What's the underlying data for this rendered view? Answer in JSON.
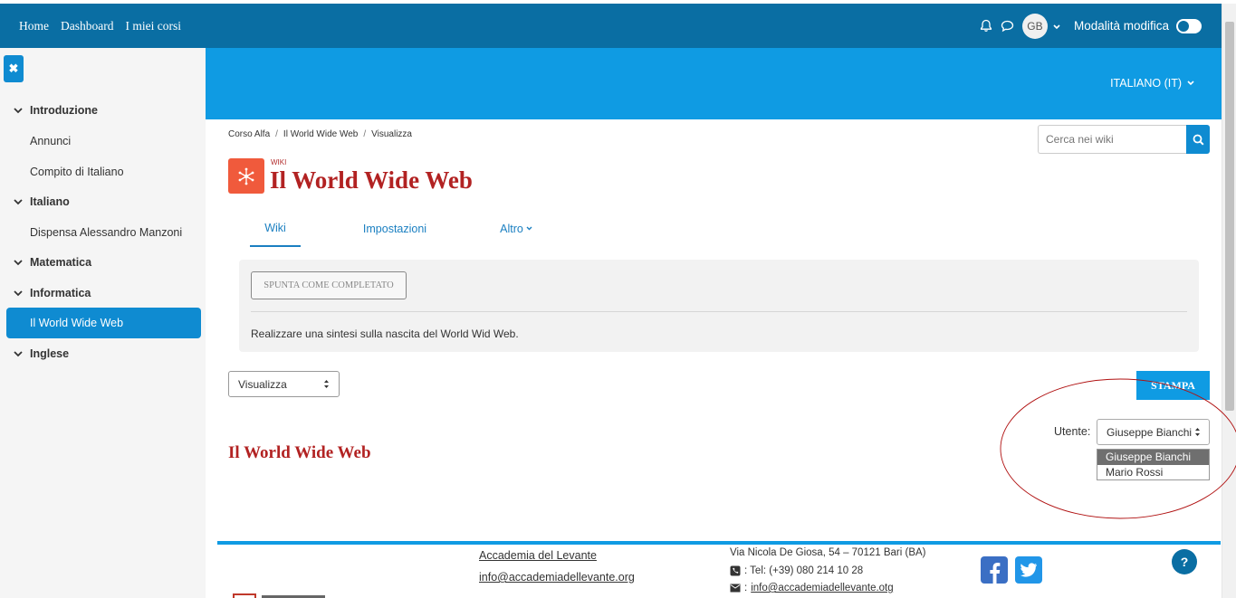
{
  "nav": {
    "home": "Home",
    "dashboard": "Dashboard",
    "my_courses": "I miei corsi",
    "avatar_initials": "GB",
    "edit_mode": "Modalità modifica"
  },
  "sidebar": {
    "close_glyph": "✖",
    "items": [
      {
        "label": "Introduzione",
        "type": "section"
      },
      {
        "label": "Annunci",
        "type": "leaf"
      },
      {
        "label": "Compito di Italiano",
        "type": "leaf"
      },
      {
        "label": "Italiano",
        "type": "section"
      },
      {
        "label": "Dispensa Alessandro Manzoni",
        "type": "leaf"
      },
      {
        "label": "Matematica",
        "type": "section"
      },
      {
        "label": "Informatica",
        "type": "section"
      },
      {
        "label": "Il World Wide Web",
        "type": "leaf",
        "active": true
      },
      {
        "label": "Inglese",
        "type": "section"
      }
    ]
  },
  "header": {
    "language": "ITALIANO (IT)"
  },
  "breadcrumb": [
    "Corso Alfa",
    "Il World Wide Web",
    "Visualizza"
  ],
  "search": {
    "placeholder": "Cerca nei wiki"
  },
  "module": {
    "type_label": "WIKI",
    "title": "Il World Wide Web"
  },
  "tabs": {
    "wiki": "Wiki",
    "settings": "Impostazioni",
    "more": "Altro"
  },
  "activity": {
    "complete_button": "SPUNTA COME COMPLETATO",
    "description": "Realizzare una sintesi sulla nascita del World Wid Web."
  },
  "view_select": {
    "value": "Visualizza"
  },
  "print_button": "STAMPA",
  "user_filter": {
    "label": "Utente:",
    "value": "Giuseppe Bianchi",
    "options": [
      "Giuseppe Bianchi",
      "Mario Rossi"
    ]
  },
  "content": {
    "page_title": "Il World Wide Web"
  },
  "footer": {
    "org_name": "Accademia del Levante",
    "org_email": "info@accademiadellevante.org",
    "address": "Via Nicola De Giosa, 54 – 70121 Bari (BA)",
    "tel": ": Tel: (+39) 080 214 10 28",
    "mail_prefix": ":",
    "mail": "info@accademiadellevante.otg",
    "help": "?"
  },
  "colors": {
    "navbar": "#0a6ea3",
    "header_band": "#0f9be3",
    "accent": "#0f8bd1",
    "title_red": "#b22222",
    "wiki_icon": "#f05a3c"
  }
}
